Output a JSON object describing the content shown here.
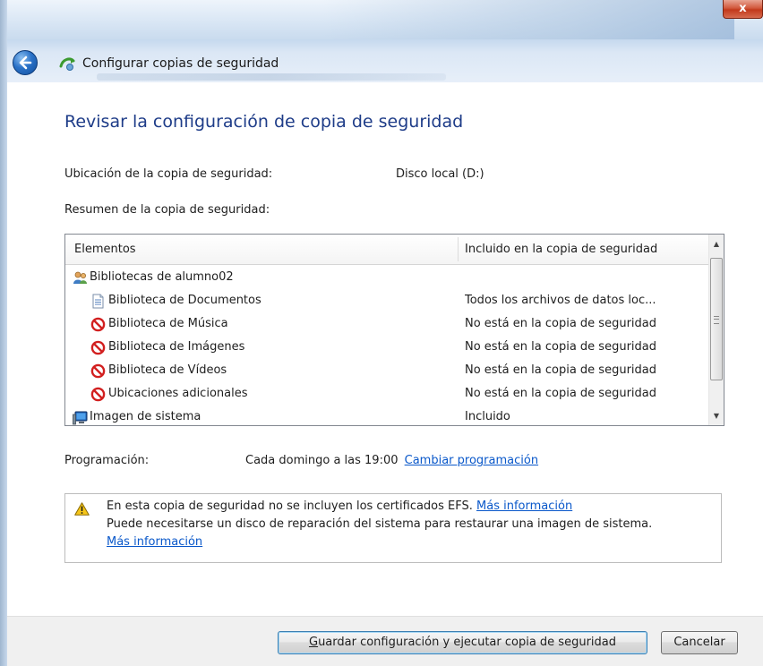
{
  "window": {
    "close_glyph": "x",
    "title": "Configurar copias de seguridad"
  },
  "page": {
    "heading": "Revisar la configuración de copia de seguridad",
    "location_label": "Ubicación de la copia de seguridad:",
    "location_value": "Disco local (D:)",
    "summary_label": "Resumen de la copia de seguridad:"
  },
  "list": {
    "columns": [
      "Elementos",
      "Incluido en la copia de seguridad"
    ],
    "rows": [
      {
        "name": "Bibliotecas de alumno02",
        "status": "",
        "icon": "users-library-icon"
      },
      {
        "name": "Biblioteca de Documentos",
        "status": "Todos los archivos de datos loc...",
        "icon": "document-icon"
      },
      {
        "name": "Biblioteca de Música",
        "status": "No está en la copia de seguridad",
        "icon": "not-included-icon"
      },
      {
        "name": "Biblioteca de Imágenes",
        "status": "No está en la copia de seguridad",
        "icon": "not-included-icon"
      },
      {
        "name": "Biblioteca de Vídeos",
        "status": "No está en la copia de seguridad",
        "icon": "not-included-icon"
      },
      {
        "name": "Ubicaciones adicionales",
        "status": "No está en la copia de seguridad",
        "icon": "not-included-icon"
      },
      {
        "name": "Imagen de sistema",
        "status": "Incluido",
        "icon": "computer-icon"
      }
    ],
    "scroll_up_glyph": "▲",
    "scroll_down_glyph": "▼"
  },
  "schedule": {
    "label": "Programación:",
    "value": "Cada domingo a las 19:00",
    "change_link": "Cambiar programación"
  },
  "info": {
    "line1": "En esta copia de seguridad no se incluyen los certificados EFS.",
    "line1_link": "Más información",
    "line2": "Puede necesitarse un disco de reparación del sistema para restaurar una imagen de sistema.",
    "line3_link": "Más información",
    "icon": "warning-icon"
  },
  "footer": {
    "save_button": "Guardar configuración y ejecutar copia de seguridad",
    "cancel_button": "Cancelar"
  },
  "colors": {
    "heading": "#1e3c88",
    "link": "#0a58ca",
    "not_included": "#d21f1f"
  }
}
